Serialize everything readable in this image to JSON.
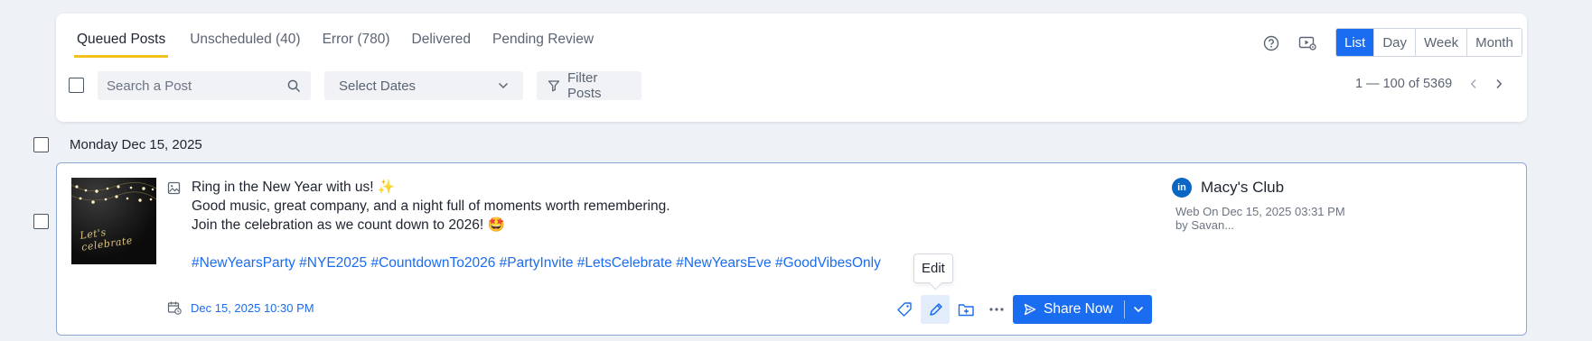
{
  "tabs": [
    {
      "label": "Queued Posts",
      "active": true
    },
    {
      "label": "Unscheduled (40)",
      "active": false
    },
    {
      "label": "Error (780)",
      "active": false
    },
    {
      "label": "Delivered",
      "active": false
    },
    {
      "label": "Pending Review",
      "active": false
    }
  ],
  "toolbar": {
    "help_icon": "question-circle-icon",
    "video_guide_icon": "play-screen-icon"
  },
  "views": [
    {
      "label": "List",
      "active": true
    },
    {
      "label": "Day",
      "active": false
    },
    {
      "label": "Week",
      "active": false
    },
    {
      "label": "Month",
      "active": false
    }
  ],
  "filters": {
    "search_placeholder": "Search a Post",
    "select_dates": "Select Dates",
    "filter_posts": "Filter Posts"
  },
  "pagination": {
    "range": "1 — 100 of 5369"
  },
  "group": {
    "date_label": "Monday Dec 15, 2025"
  },
  "post": {
    "lines": [
      "Ring in the New Year with us! ✨",
      "Good music, great company, and a night full of moments worth remembering.",
      "Join the celebration as we count down to 2026! 🤩"
    ],
    "hashtags": "#NewYearsParty #NYE2025 #CountdownTo2026 #PartyInvite #LetsCelebrate #NewYearsEve #GoodVibesOnly",
    "schedule": "Dec 15, 2025 10:30 PM",
    "thumbnail_text": "Let's celebrate",
    "tooltip": "Edit",
    "share_label": "Share Now",
    "account": {
      "network": "in",
      "name": "Macy's Club",
      "meta_line1": "Web On Dec 15, 2025 03:31 PM",
      "meta_line2": "by Savan..."
    }
  },
  "colors": {
    "accent": "#1a6cf0",
    "tab_underline": "#f2c21a",
    "linkedin": "#0a66c2",
    "page_bg": "#eef1f6"
  }
}
